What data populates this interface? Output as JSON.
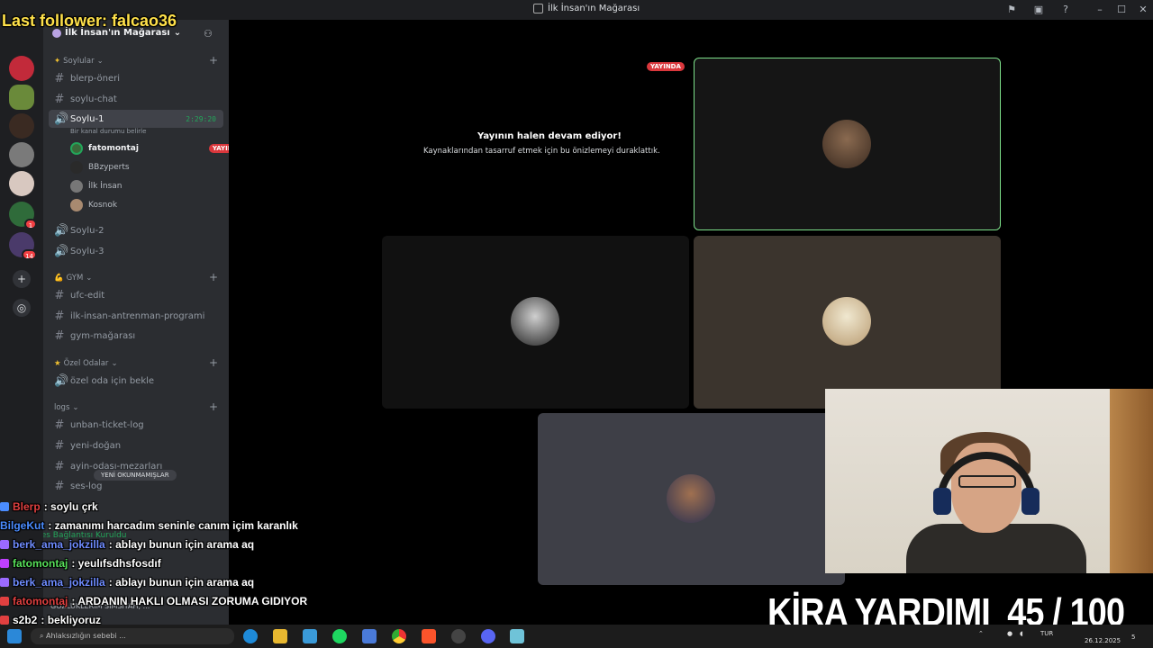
{
  "window": {
    "title": "İlk İnsan'ın Mağarası"
  },
  "overlay": {
    "last_follower": "Last follower: falcao36",
    "goal_label": "KİRA YARDIMI",
    "goal_current": "45",
    "goal_sep": "/",
    "goal_total": "100"
  },
  "server": {
    "name": "İlk İnsan'ın Mağarası"
  },
  "rail": {
    "badges": [
      "1",
      "14"
    ]
  },
  "categories": {
    "soylular": "Soylular",
    "gym": "GYM",
    "ozel": "Özel Odalar",
    "logs": "logs"
  },
  "channels": {
    "blerp": "blerp-öneri",
    "soylu_chat": "soylu-chat",
    "soylu1": "Soylu-1",
    "soylu1_timer": "2:29:20",
    "soylu1_status": "Bir kanal durumu belirle",
    "soylu2": "Soylu-2",
    "soylu3": "Soylu-3",
    "ufc": "ufc-edit",
    "antrenman": "ilk-insan-antrenman-programi",
    "gym_magarasi": "gym-mağarası",
    "ozel_oda": "özel oda için bekle",
    "unban": "unban-ticket-log",
    "yeni_dogan": "yeni-doğan",
    "ayin": "ayin-odası-mezarları",
    "ses_log": "ses-log"
  },
  "voice_users": [
    {
      "name": "fatomontaj",
      "live": "YAYINDA"
    },
    {
      "name": "BBzyperts"
    },
    {
      "name": "İlk İnsan"
    },
    {
      "name": "Kosnok"
    }
  ],
  "unread_pill": "YENİ OKUNMAMIŞLAR",
  "stage": {
    "live_badge": "YAYINDA",
    "paused_title": "Yayının halen devam ediyor!",
    "paused_sub": "Kaynaklarından tasarruf etmek için bu önizlemeyi duraklattık."
  },
  "chat": [
    {
      "user": "Blerp",
      "user_color": "#e04040",
      "text": ": soylu çrk"
    },
    {
      "user": "BilgeKut",
      "user_color": "#4a8cff",
      "text": ": zamanımı harcadım seninle canım içim karanlık"
    },
    {
      "user": "berk_ama_jokzilla",
      "user_color": "#6f8cff",
      "text": ": ablayı bunun için arama aq"
    },
    {
      "user": "fatomontaj",
      "user_color": "#57e05a",
      "text": ": yeulıfsdhsfosdıf"
    },
    {
      "user": "berk_ama_jokzilla",
      "user_color": "#6f8cff",
      "text": ": ablayı bunun için arama aq"
    },
    {
      "user": "fatomontaj",
      "user_color": "#e04040",
      "text": ": ARDANIN HAKLI OLMASI ZORUMA GIDIYOR"
    },
    {
      "user": "s2b2",
      "user_color": "#ffffff",
      "text": ": bekliyoruz"
    }
  ],
  "ghost": {
    "voice_connected": "Ses Bağlantısı Kuruldu",
    "user_status": "GÖZLÜKLERİM SİMSİYAH, ...",
    "search": "Ahlaksızlığın sebebi ..."
  },
  "taskbar": {
    "lang": "TUR",
    "date": "26.12.2025",
    "notif_count": "5"
  },
  "colors": {
    "accent": "#5865f2",
    "live": "#da373c",
    "speaking": "#23a55a",
    "follower": "#ffe14a"
  }
}
